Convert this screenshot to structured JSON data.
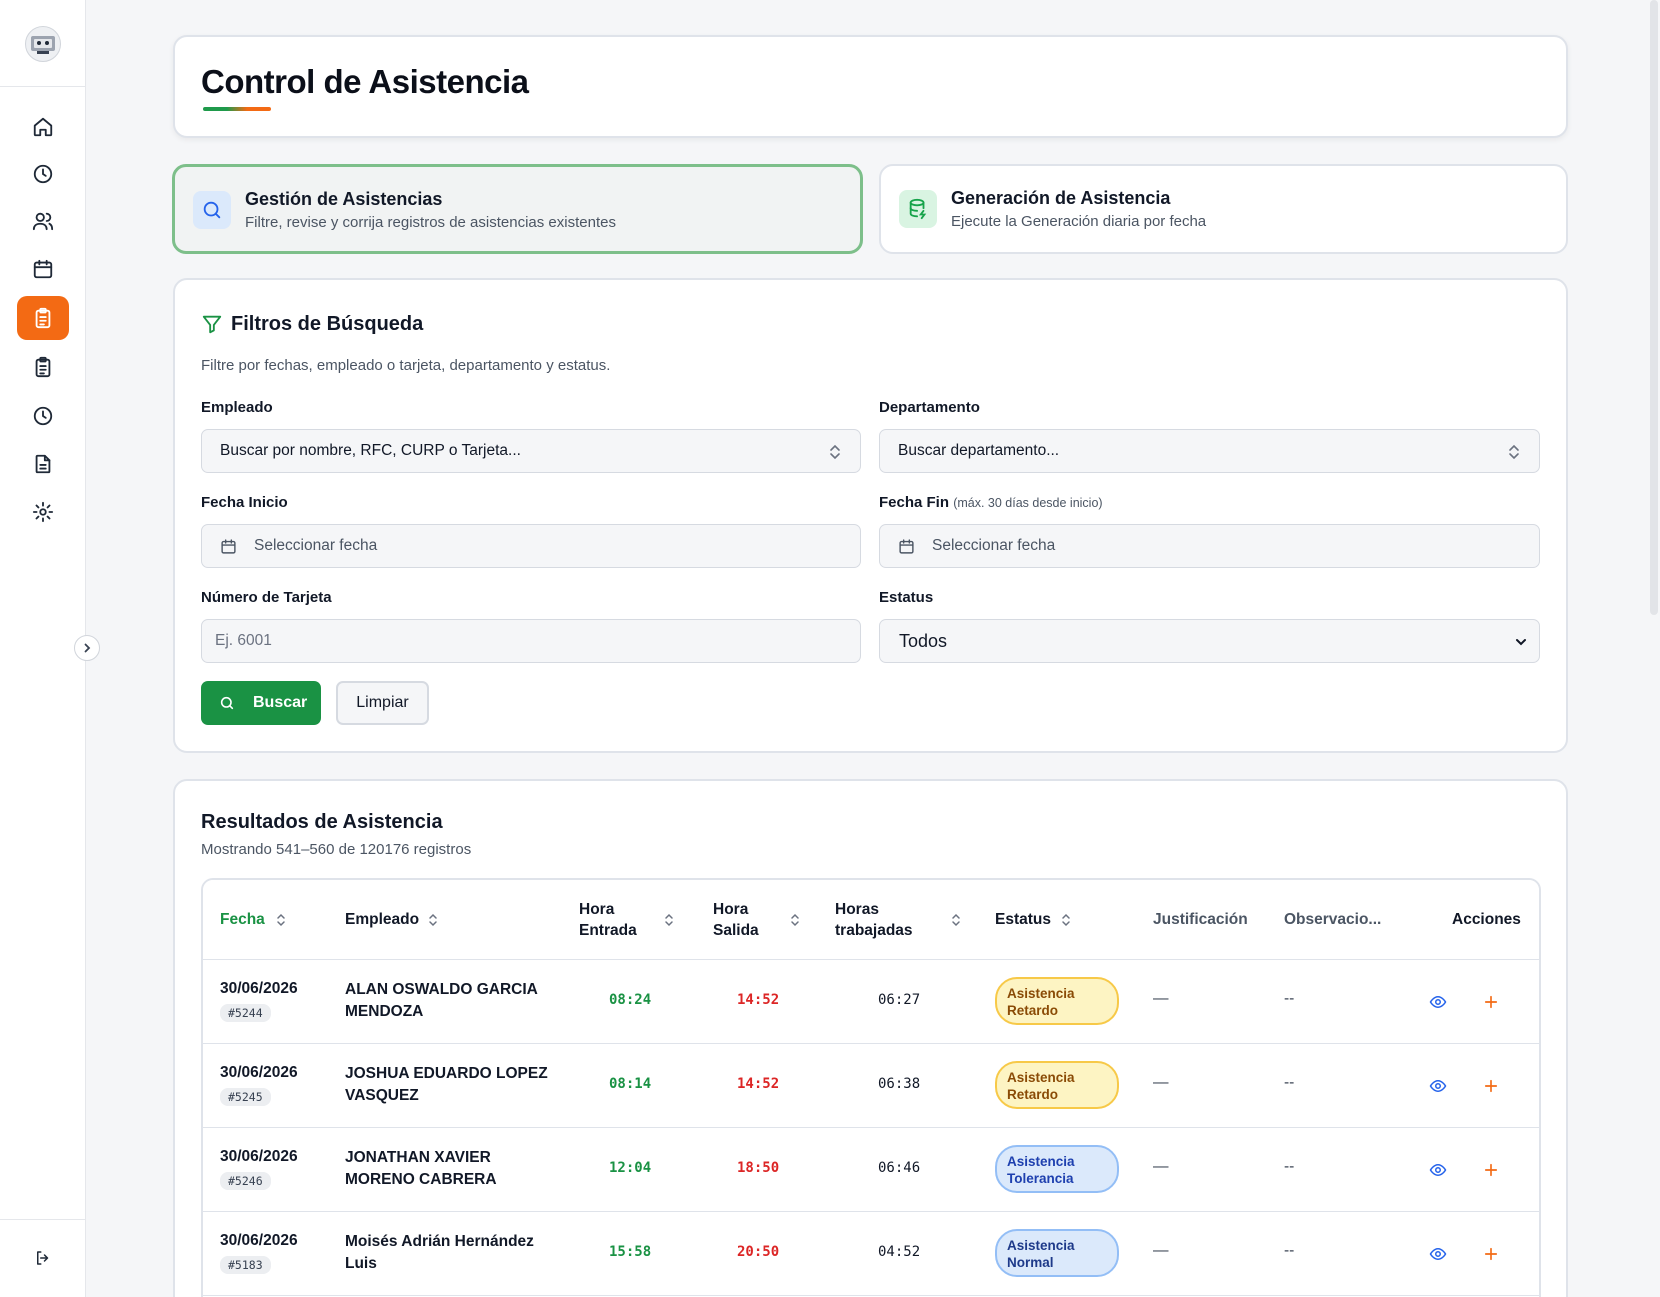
{
  "page": {
    "title": "Control de Asistencia"
  },
  "modes": [
    {
      "title": "Gestión de Asistencias",
      "subtitle": "Filtre, revise y corrija registros de asistencias existentes",
      "icon": "search-icon",
      "active": true
    },
    {
      "title": "Generación de Asistencia",
      "subtitle": "Ejecute la Generación diaria por fecha",
      "icon": "database-bolt-icon",
      "active": false
    }
  ],
  "sidebar": {
    "items": [
      {
        "icon": "home-icon"
      },
      {
        "icon": "clock-icon"
      },
      {
        "icon": "users-icon"
      },
      {
        "icon": "calendar-icon"
      },
      {
        "icon": "clipboard-list-icon",
        "active": true
      },
      {
        "icon": "clipboard-check-icon"
      },
      {
        "icon": "clock-alt-icon"
      },
      {
        "icon": "document-icon"
      },
      {
        "icon": "gear-icon"
      }
    ],
    "logout_icon": "logout-icon"
  },
  "filters": {
    "title": "Filtros de Búsqueda",
    "hint": "Filtre por fechas, empleado o tarjeta, departamento y estatus.",
    "employee": {
      "label": "Empleado",
      "value": "Buscar por nombre, RFC, CURP o Tarjeta..."
    },
    "department": {
      "label": "Departamento",
      "value": "Buscar departamento..."
    },
    "start_date": {
      "label": "Fecha Inicio",
      "placeholder": "Seleccionar fecha"
    },
    "end_date": {
      "label": "Fecha Fin",
      "note": "(máx. 30 días desde inicio)",
      "placeholder": "Seleccionar fecha"
    },
    "card_number": {
      "label": "Número de Tarjeta",
      "placeholder": "Ej. 6001"
    },
    "status": {
      "label": "Estatus",
      "value": "Todos"
    },
    "search_label": "Buscar",
    "clear_label": "Limpiar"
  },
  "results": {
    "title": "Resultados de Asistencia",
    "summary": "Mostrando 541–560 de 120176 registros",
    "columns": {
      "fecha": "Fecha",
      "empleado": "Empleado",
      "hora_entrada_1": "Hora",
      "hora_entrada_2": "Entrada",
      "hora_salida_1": "Hora",
      "hora_salida_2": "Salida",
      "horas_1": "Horas",
      "horas_2": "trabajadas",
      "estatus": "Estatus",
      "justificacion": "Justificación",
      "observaciones": "Observacio...",
      "acciones": "Acciones"
    },
    "rows": [
      {
        "date": "30/06/2026",
        "card": "#5244",
        "name_1": "ALAN OSWALDO GARCIA",
        "name_2": "MENDOZA",
        "in": "08:24",
        "out": "14:52",
        "worked": "06:27",
        "status_1": "Asistencia",
        "status_2": "Retardo",
        "status_type": "retardo",
        "justification": "—",
        "observation": "--"
      },
      {
        "date": "30/06/2026",
        "card": "#5245",
        "name_1": "JOSHUA EDUARDO LOPEZ",
        "name_2": "VASQUEZ",
        "in": "08:14",
        "out": "14:52",
        "worked": "06:38",
        "status_1": "Asistencia",
        "status_2": "Retardo",
        "status_type": "retardo",
        "justification": "—",
        "observation": "--"
      },
      {
        "date": "30/06/2026",
        "card": "#5246",
        "name_1": "JONATHAN XAVIER",
        "name_2": "MORENO CABRERA",
        "in": "12:04",
        "out": "18:50",
        "worked": "06:46",
        "status_1": "Asistencia",
        "status_2": "Tolerancia",
        "status_type": "tolerancia",
        "justification": "—",
        "observation": "--"
      },
      {
        "date": "30/06/2026",
        "card": "#5183",
        "name_1": "Moisés Adrián Hernández",
        "name_2": "Luis",
        "in": "15:58",
        "out": "20:50",
        "worked": "04:52",
        "status_1": "Asistencia",
        "status_2": "Normal",
        "status_type": "normal",
        "justification": "—",
        "observation": "--"
      }
    ]
  }
}
